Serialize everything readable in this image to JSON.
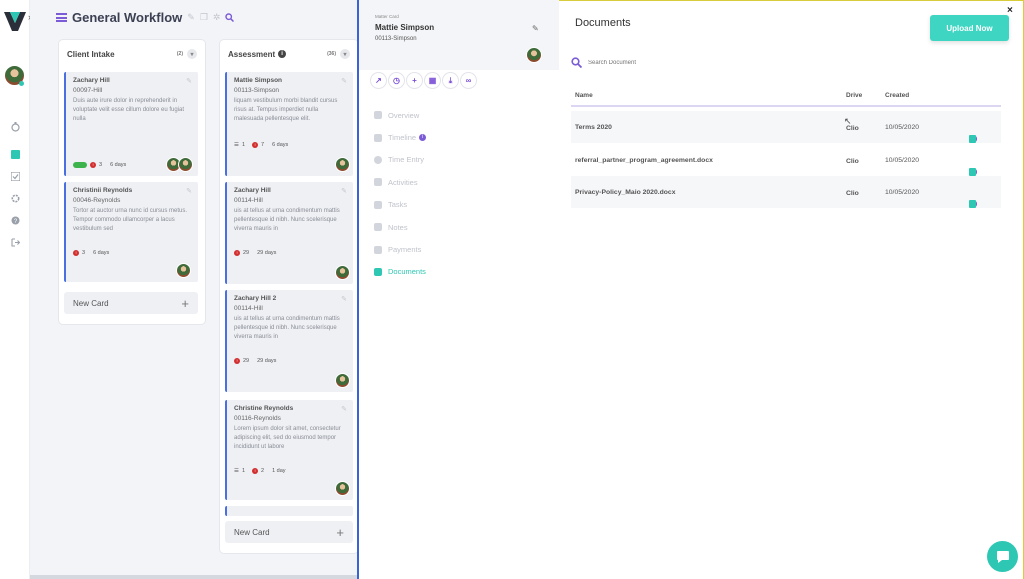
{
  "board": {
    "title": "General Workflow",
    "columns": [
      {
        "name": "Client Intake",
        "count": "(2)",
        "cards": [
          {
            "name": "Zachary Hill",
            "number": "00097-Hill",
            "description": "Duis aute irure dolor in reprehenderit in voluptate velit esse cillum dolore eu fugiat nulla",
            "alerts": "3",
            "days": "6 days"
          },
          {
            "name": "Christinii Reynolds",
            "number": "00046-Reynolds",
            "description": "Tortor at auctor urna nunc id cursus metus. Tempor commodo ullamcorper a lacus vestibulum sed",
            "alerts": "3",
            "days": "6 days"
          }
        ],
        "new_card_label": "New Card"
      },
      {
        "name": "Assessment",
        "count": "(36)",
        "cards": [
          {
            "name": "Mattie Simpson",
            "number": "00113-Simpson",
            "description": "liquam vestibulum morbi blandit cursus risus at. Tempus imperdiet nulla malesuada pellentesque elit.",
            "tasks": "1",
            "alerts": "7",
            "days": "6 days"
          },
          {
            "name": "Zachary Hill",
            "number": "00114-Hill",
            "description": "uis at tellus at urna condimentum mattis pellentesque id nibh. Nunc scelerisque viverra mauris in",
            "alerts": "29",
            "days": "29 days"
          },
          {
            "name": "Zachary Hill 2",
            "number": "00114-Hill",
            "description": "uis at tellus at urna condimentum mattis pellentesque id nibh. Nunc scelerisque viverra mauris in",
            "alerts": "29",
            "days": "29 days"
          },
          {
            "name": "Christine Reynolds",
            "number": "00116-Reynolds",
            "description": "Lorem ipsum dolor sit amet, consectetur adipiscing elit, sed do eiusmod tempor incididunt ut labore",
            "tasks": "1",
            "alerts": "2",
            "days": "1 day"
          }
        ],
        "new_card_label": "New Card"
      }
    ]
  },
  "matter": {
    "label": "Matter Card",
    "name": "Mattie Simpson",
    "number": "00113-Simpson",
    "menu": [
      {
        "label": "Overview"
      },
      {
        "label": "Timeline",
        "badge": "i"
      },
      {
        "label": "Time Entry"
      },
      {
        "label": "Activities"
      },
      {
        "label": "Tasks"
      },
      {
        "label": "Notes"
      },
      {
        "label": "Payments"
      },
      {
        "label": "Documents",
        "active": true
      }
    ]
  },
  "documents": {
    "title": "Documents",
    "upload_label": "Upload Now",
    "search_placeholder": "Search Document",
    "columns": {
      "name": "Name",
      "drive": "Drive",
      "created": "Created"
    },
    "rows": [
      {
        "name": "Terms 2020",
        "drive": "Clio",
        "created": "10/05/2020"
      },
      {
        "name": "referral_partner_program_agreement.docx",
        "drive": "Clio",
        "created": "10/05/2020"
      },
      {
        "name": "Privacy-Policy_Maio 2020.docx",
        "drive": "Clio",
        "created": "10/05/2020"
      }
    ]
  },
  "colors": {
    "accent": "#2ec7b3",
    "purple": "#7b4fd6",
    "card_border": "#4a6fe0",
    "alert": "#d32f2f"
  }
}
